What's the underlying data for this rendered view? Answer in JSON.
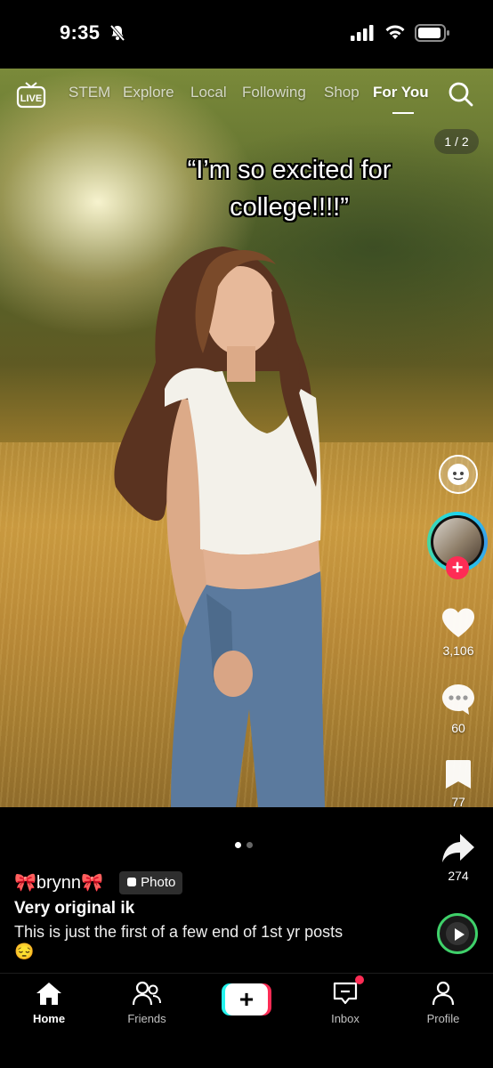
{
  "status_bar": {
    "time": "9:35"
  },
  "top_nav": {
    "live_label": "LIVE",
    "tabs": [
      "STEM",
      "Explore",
      "Local",
      "Following",
      "Shop",
      "For You"
    ],
    "active_tab": "For You"
  },
  "post": {
    "page_counter": "1 / 2",
    "caption_line1": "“I’m so excited for",
    "caption_line2": "college!!!!”",
    "likes": "3,106",
    "comments": "60",
    "saves": "77",
    "shares": "274",
    "username": "brynn",
    "username_emoji": "🎀",
    "badge": "Photo",
    "title": "Very original ik",
    "description": "This is just the first of a few end of 1st yr posts😔",
    "carousel": {
      "total": 2,
      "current": 1
    }
  },
  "tab_bar": {
    "home": "Home",
    "friends": "Friends",
    "inbox": "Inbox",
    "profile": "Profile",
    "create": "+"
  },
  "colors": {
    "accent_red": "#fe2c55",
    "accent_cyan": "#25f4ee",
    "music_ring": "#3fd16a"
  }
}
